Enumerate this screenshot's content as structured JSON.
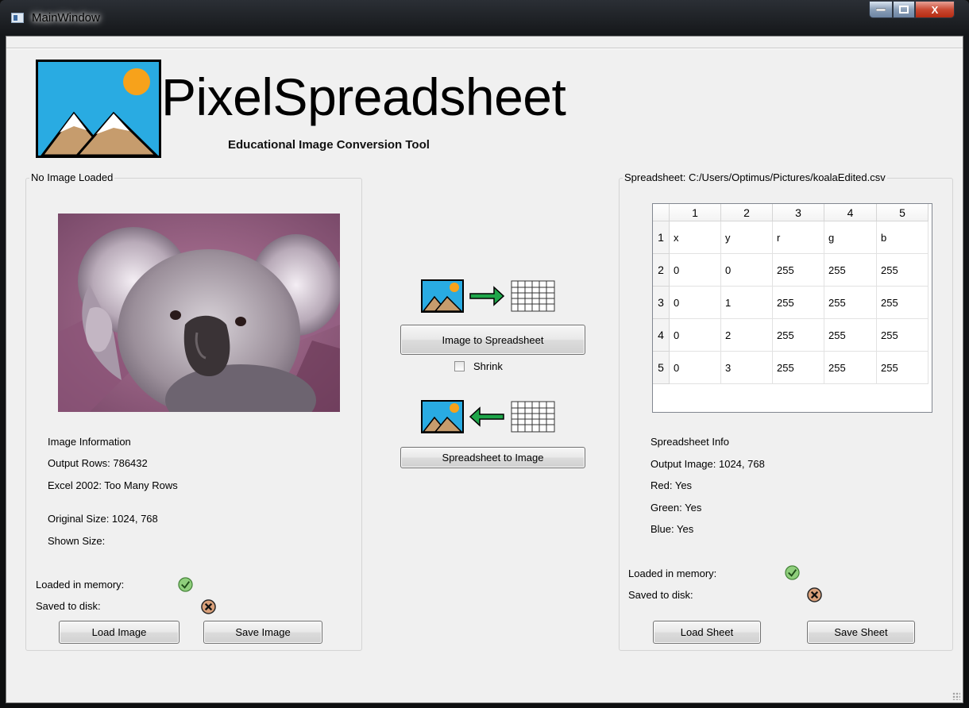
{
  "window": {
    "title": "MainWindow",
    "minimize": "minimize",
    "maximize": "maximize",
    "close": "X"
  },
  "header": {
    "app_name": "PixelSpreadsheet",
    "subtitle": "Educational Image Conversion Tool"
  },
  "left_panel": {
    "title": "No Image Loaded",
    "image_alt": "koala photograph",
    "info": [
      "Image Information",
      "Output Rows: 786432",
      "Excel 2002: Too Many Rows",
      "Original Size: 1024, 768",
      "Shown Size:"
    ],
    "loaded_label": "Loaded in memory:",
    "saved_label": "Saved to disk:",
    "loaded_status": "check-icon",
    "saved_status": "x-icon",
    "load_button": "Load Image",
    "save_button": "Save Image"
  },
  "center": {
    "to_sheet_button": "Image to Spreadsheet",
    "shrink_label": "Shrink",
    "shrink_checked": false,
    "to_image_button": "Spreadsheet to Image",
    "arrow_right_color": "#1fa64a",
    "arrow_left_color": "#1fa64a"
  },
  "right_panel": {
    "title": "Spreadsheet: C:/Users/Optimus/Pictures/koalaEdited.csv",
    "table": {
      "columns": [
        "1",
        "2",
        "3",
        "4",
        "5"
      ],
      "row_headers": [
        "1",
        "2",
        "3",
        "4",
        "5"
      ],
      "rows": [
        [
          "x",
          "y",
          "r",
          "g",
          "b"
        ],
        [
          "0",
          "0",
          "255",
          "255",
          "255"
        ],
        [
          "0",
          "1",
          "255",
          "255",
          "255"
        ],
        [
          "0",
          "2",
          "255",
          "255",
          "255"
        ],
        [
          "0",
          "3",
          "255",
          "255",
          "255"
        ]
      ]
    },
    "info": [
      "Spreadsheet Info",
      "Output Image: 1024, 768",
      "Red: Yes",
      "Green: Yes",
      "Blue: Yes"
    ],
    "loaded_label": "Loaded in memory:",
    "saved_label": "Saved to disk:",
    "loaded_status": "check-icon",
    "saved_status": "x-icon",
    "load_button": "Load Sheet",
    "save_button": "Save Sheet"
  },
  "colors": {
    "logo_sky": "#29abe2",
    "logo_sun": "#f7a21b",
    "logo_mountain": "#c69c6d",
    "check_green": "#8fce7c",
    "x_fill": "#d9a07a"
  }
}
